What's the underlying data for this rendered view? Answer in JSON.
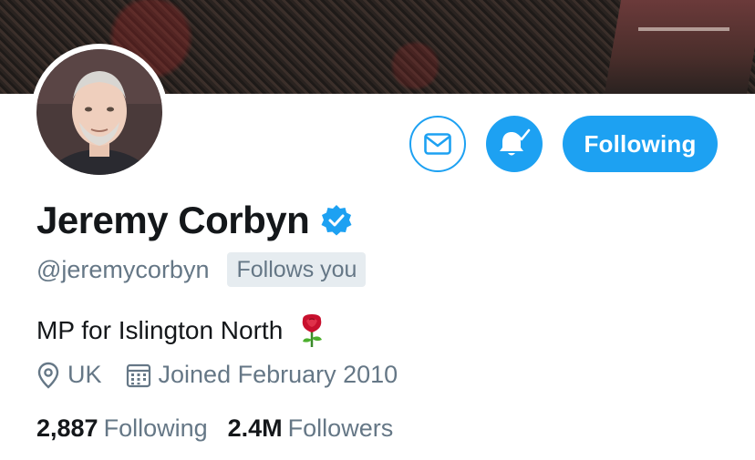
{
  "profile": {
    "name": "Jeremy Corbyn",
    "handle": "@jeremycorbyn",
    "follows_you_label": "Follows you",
    "bio": "MP for Islington North",
    "location": "UK",
    "joined": "Joined February 2010",
    "verified": true
  },
  "actions": {
    "following_label": "Following",
    "message_icon": "envelope-icon",
    "notifications_icon": "bell-check-icon"
  },
  "stats": {
    "following_count": "2,887",
    "following_label": "Following",
    "followers_count": "2.4M",
    "followers_label": "Followers"
  },
  "icons": {
    "location": "location-pin-icon",
    "joined": "calendar-icon",
    "verified": "verified-badge-icon",
    "bio_emoji": "rose-icon"
  },
  "colors": {
    "accent": "#1da1f2",
    "text_primary": "#14171a",
    "text_secondary": "#657786",
    "badge_bg": "#e6ecf0"
  }
}
